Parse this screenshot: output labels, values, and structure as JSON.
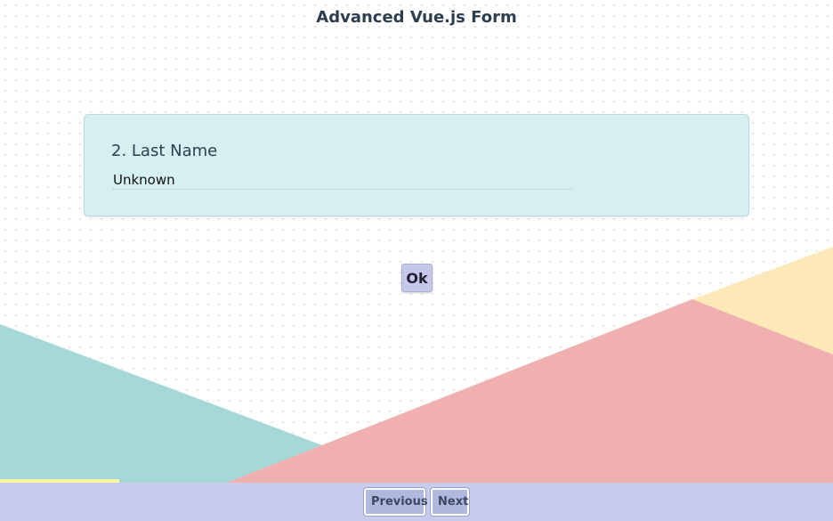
{
  "page": {
    "title": "Advanced Vue.js Form"
  },
  "question": {
    "label": "2. Last Name",
    "value": "Unknown",
    "ok_label": "Ok"
  },
  "footer": {
    "previous_label": "Previous",
    "next_label": "Next",
    "progress_fraction": 0.143
  },
  "colors": {
    "card_background": "#d6eff0",
    "footer_background": "#c8cbeb",
    "shape_teal": "#a7d8d8",
    "shape_pink": "#f0b0b0",
    "shape_yellow": "#fde8b7",
    "progress_yellow": "#fbf3a6"
  }
}
